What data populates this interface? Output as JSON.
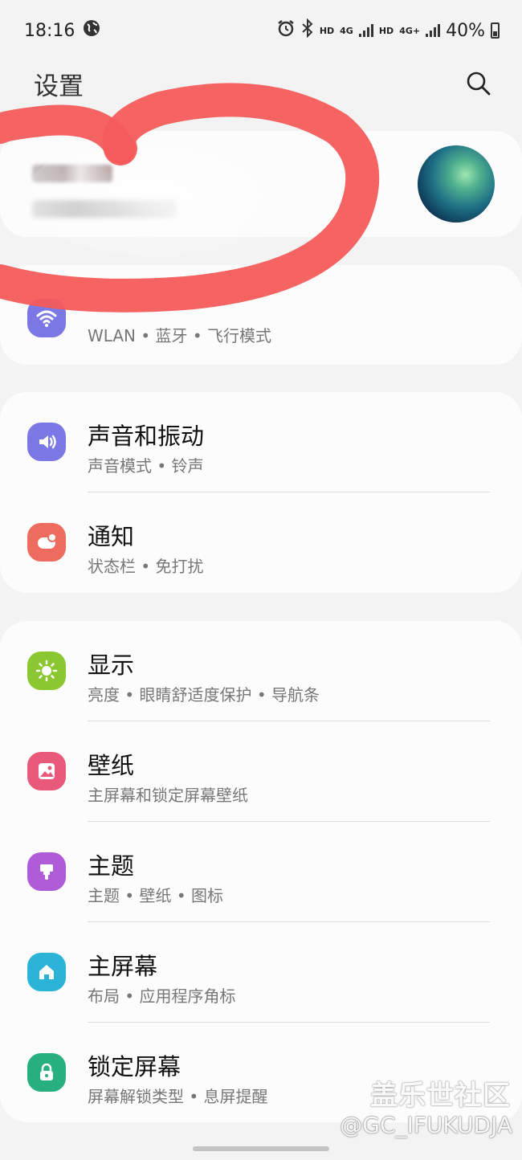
{
  "status_bar": {
    "time": "18:16",
    "hd1": "HD",
    "net1": "4G",
    "hd2": "HD",
    "net2": "4G+",
    "battery": "40%"
  },
  "header": {
    "title": "设置"
  },
  "account": {
    "avatar_colors": [
      "#0b2f4d",
      "#4fb08e",
      "#9fe6b0"
    ]
  },
  "network": {
    "subtitle": "WLAN • 蓝牙 • 飞行模式",
    "icon": "wifi-icon",
    "icon_color": "#7b78e6"
  },
  "groups": [
    {
      "items": [
        {
          "title": "声音和振动",
          "subtitle": "声音模式 • 铃声",
          "icon": "speaker-icon",
          "color": "#7b78e6"
        },
        {
          "title": "通知",
          "subtitle": "状态栏 • 免打扰",
          "icon": "notification-icon",
          "color": "#ee6c5e"
        }
      ]
    },
    {
      "items": [
        {
          "title": "显示",
          "subtitle": "亮度 • 眼睛舒适度保护 • 导航条",
          "icon": "sun-icon",
          "color": "#8bc730"
        },
        {
          "title": "壁纸",
          "subtitle": "主屏幕和锁定屏幕壁纸",
          "icon": "picture-icon",
          "color": "#e8597a"
        },
        {
          "title": "主题",
          "subtitle": "主题 • 壁纸 • 图标",
          "icon": "brush-icon",
          "color": "#b05bd8"
        },
        {
          "title": "主屏幕",
          "subtitle": "布局 • 应用程序角标",
          "icon": "home-icon",
          "color": "#2bb3d8"
        },
        {
          "title": "锁定屏幕",
          "subtitle": "屏幕解锁类型 • 息屏提醒",
          "icon": "lock-icon",
          "color": "#27b07d"
        }
      ]
    }
  ],
  "watermark": {
    "line1": "盖乐世社区",
    "line2": "@GC_IFUKUDJA"
  }
}
